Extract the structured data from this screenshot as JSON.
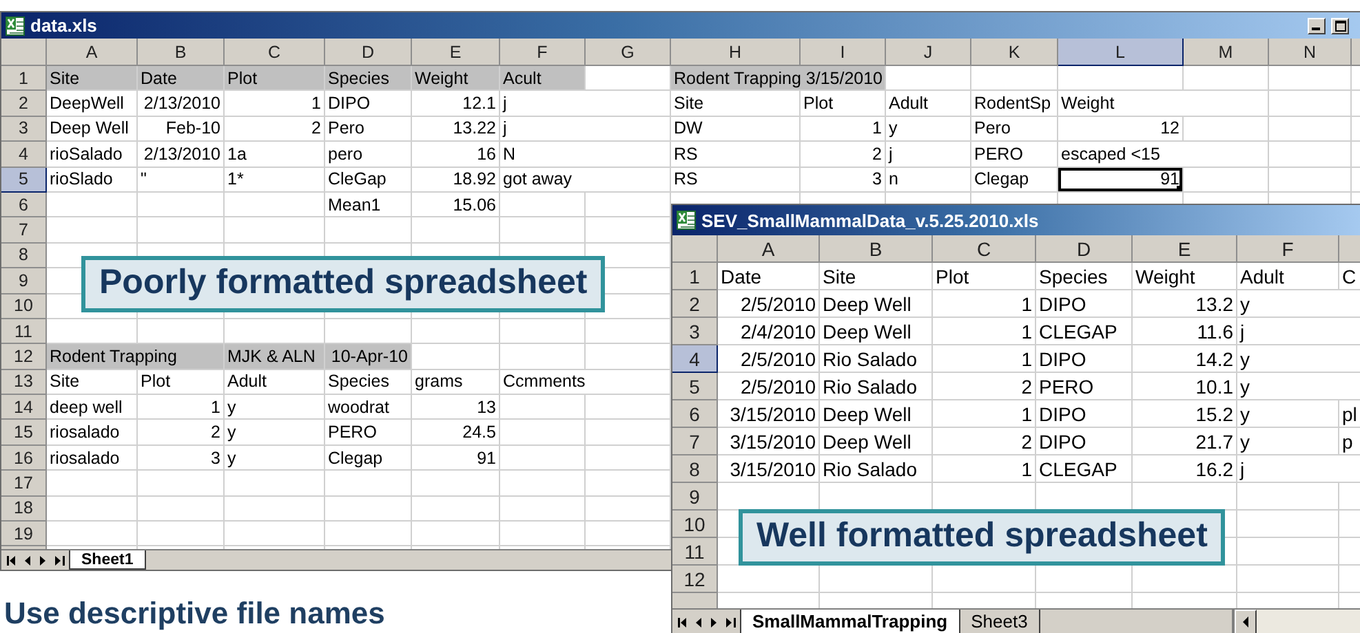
{
  "windows": [
    {
      "title": "data.xls",
      "callout": "Poorly formatted spreadsheet",
      "columns": [
        {
          "label": "A",
          "selected": false
        },
        {
          "label": "B",
          "selected": false
        },
        {
          "label": "C",
          "selected": false
        },
        {
          "label": "D",
          "selected": false
        },
        {
          "label": "E",
          "selected": false
        },
        {
          "label": "F",
          "selected": false
        },
        {
          "label": "G",
          "selected": false
        },
        {
          "label": "H",
          "selected": false
        },
        {
          "label": "I",
          "selected": false
        },
        {
          "label": "J",
          "selected": false
        },
        {
          "label": "K",
          "selected": false
        },
        {
          "label": "L",
          "selected": true
        },
        {
          "label": "M",
          "selected": false
        },
        {
          "label": "N",
          "selected": false
        }
      ],
      "rows": [
        {
          "label": "1",
          "selected": false,
          "cells": [
            {
              "text": "Site",
              "kind": "text",
              "shaded": true
            },
            {
              "text": "Date",
              "kind": "text",
              "shaded": true
            },
            {
              "text": "Plot",
              "kind": "text",
              "shaded": true
            },
            {
              "text": "Species",
              "kind": "text",
              "shaded": true
            },
            {
              "text": "Weight",
              "kind": "text",
              "shaded": true
            },
            {
              "text": "Acult",
              "kind": "text",
              "shaded": true
            },
            null,
            {
              "text": "Rodent Trapping 3/15/2010",
              "kind": "text",
              "shaded": true
            },
            {
              "shaded": true
            }
          ]
        },
        {
          "label": "2",
          "selected": false,
          "cells": [
            {
              "text": "DeepWell",
              "kind": "text",
              "shaded": false
            },
            {
              "text": "2/13/2010",
              "kind": "number",
              "shaded": false
            },
            {
              "text": "1",
              "kind": "number",
              "shaded": false
            },
            {
              "text": "DIPO",
              "kind": "text",
              "shaded": false
            },
            {
              "text": "12.1",
              "kind": "number",
              "shaded": false
            },
            {
              "text": "j",
              "kind": "text",
              "shaded": false
            },
            null,
            {
              "text": "Site",
              "kind": "text",
              "shaded": false
            },
            {
              "text": "Plot",
              "kind": "text",
              "shaded": false
            },
            {
              "text": "Adult",
              "kind": "text",
              "shaded": false
            },
            {
              "text": "RodentSp",
              "kind": "text",
              "shaded": false
            },
            {
              "text": "Weight",
              "kind": "text",
              "shaded": false
            }
          ]
        },
        {
          "label": "3",
          "selected": false,
          "cells": [
            {
              "text": "Deep Well",
              "kind": "text",
              "shaded": false
            },
            {
              "text": "Feb-10",
              "kind": "number",
              "shaded": false
            },
            {
              "text": "2",
              "kind": "number",
              "shaded": false
            },
            {
              "text": "Pero",
              "kind": "text",
              "shaded": false
            },
            {
              "text": "13.22",
              "kind": "number",
              "shaded": false
            },
            {
              "text": "j",
              "kind": "text",
              "shaded": false
            },
            null,
            {
              "text": "DW",
              "kind": "text",
              "shaded": false
            },
            {
              "text": "1",
              "kind": "number",
              "shaded": false
            },
            {
              "text": "y",
              "kind": "text",
              "shaded": false
            },
            {
              "text": "Pero",
              "kind": "text",
              "shaded": false
            },
            {
              "text": "12",
              "kind": "number",
              "shaded": false
            }
          ]
        },
        {
          "label": "4",
          "selected": false,
          "cells": [
            {
              "text": "rioSalado",
              "kind": "text",
              "shaded": false
            },
            {
              "text": "2/13/2010",
              "kind": "number",
              "shaded": false
            },
            {
              "text": "1a",
              "kind": "text",
              "shaded": false
            },
            {
              "text": "pero",
              "kind": "text",
              "shaded": false
            },
            {
              "text": "16",
              "kind": "number",
              "shaded": false
            },
            {
              "text": "N",
              "kind": "text",
              "shaded": false
            },
            null,
            {
              "text": "RS",
              "kind": "text",
              "shaded": false
            },
            {
              "text": "2",
              "kind": "number",
              "shaded": false
            },
            {
              "text": "j",
              "kind": "text",
              "shaded": false
            },
            {
              "text": "PERO",
              "kind": "text",
              "shaded": false
            },
            {
              "text": "escaped <15",
              "kind": "text",
              "shaded": false
            }
          ]
        },
        {
          "label": "5",
          "selected": true,
          "cells": [
            {
              "text": "rioSlado",
              "kind": "text",
              "shaded": false
            },
            {
              "text": "\"",
              "kind": "text",
              "shaded": false
            },
            {
              "text": "1*",
              "kind": "text",
              "shaded": false
            },
            {
              "text": "CleGap",
              "kind": "text",
              "shaded": false
            },
            {
              "text": "18.92",
              "kind": "number",
              "shaded": false
            },
            {
              "text": "got away",
              "kind": "text",
              "shaded": false
            },
            null,
            {
              "text": "RS",
              "kind": "text",
              "shaded": false
            },
            {
              "text": "3",
              "kind": "number",
              "shaded": false
            },
            {
              "text": "n",
              "kind": "text",
              "shaded": false
            },
            {
              "text": "Clegap",
              "kind": "text",
              "shaded": false
            },
            {
              "text": "91",
              "kind": "number",
              "shaded": false
            }
          ]
        },
        {
          "label": "6",
          "selected": false,
          "cells": [
            null,
            null,
            null,
            {
              "text": "Mean1",
              "kind": "text",
              "shaded": false
            },
            {
              "text": "15.06",
              "kind": "number",
              "shaded": false
            }
          ]
        },
        {
          "label": "7",
          "selected": false,
          "cells": []
        },
        {
          "label": "8",
          "selected": false,
          "cells": []
        },
        {
          "label": "9",
          "selected": false,
          "cells": []
        },
        {
          "label": "10",
          "selected": false,
          "cells": []
        },
        {
          "label": "11",
          "selected": false,
          "cells": []
        },
        {
          "label": "12",
          "selected": false,
          "cells": [
            {
              "text": "Rodent Trapping",
              "kind": "text",
              "shaded": true
            },
            {
              "shaded": true
            },
            {
              "text": "MJK & ALN",
              "kind": "text",
              "shaded": true
            },
            {
              "text": "10-Apr-10",
              "kind": "number",
              "shaded": true
            }
          ]
        },
        {
          "label": "13",
          "selected": false,
          "cells": [
            {
              "text": "Site",
              "kind": "text",
              "shaded": false
            },
            {
              "text": "Plot",
              "kind": "text",
              "shaded": false
            },
            {
              "text": "Adult",
              "kind": "text",
              "shaded": false
            },
            {
              "text": "Species",
              "kind": "text",
              "shaded": false
            },
            {
              "text": "grams",
              "kind": "text",
              "shaded": false
            },
            {
              "text": "Ccmments",
              "kind": "text",
              "shaded": false
            }
          ]
        },
        {
          "label": "14",
          "selected": false,
          "cells": [
            {
              "text": "deep well",
              "kind": "text",
              "shaded": false
            },
            {
              "text": "1",
              "kind": "number",
              "shaded": false
            },
            {
              "text": "y",
              "kind": "text",
              "shaded": false
            },
            {
              "text": "woodrat",
              "kind": "text",
              "shaded": false
            },
            {
              "text": "13",
              "kind": "number",
              "shaded": false
            }
          ]
        },
        {
          "label": "15",
          "selected": false,
          "cells": [
            {
              "text": "riosalado",
              "kind": "text",
              "shaded": false
            },
            {
              "text": "2",
              "kind": "number",
              "shaded": false
            },
            {
              "text": "y",
              "kind": "text",
              "shaded": false
            },
            {
              "text": "PERO",
              "kind": "text",
              "shaded": false
            },
            {
              "text": "24.5",
              "kind": "number",
              "shaded": false
            }
          ]
        },
        {
          "label": "16",
          "selected": false,
          "cells": [
            {
              "text": "riosalado",
              "kind": "text",
              "shaded": false
            },
            {
              "text": "3",
              "kind": "number",
              "shaded": false
            },
            {
              "text": "y",
              "kind": "text",
              "shaded": false
            },
            {
              "text": "Clegap",
              "kind": "text",
              "shaded": false
            },
            {
              "text": "91",
              "kind": "number",
              "shaded": false
            }
          ]
        },
        {
          "label": "17",
          "selected": false,
          "cells": []
        },
        {
          "label": "18",
          "selected": false,
          "cells": []
        },
        {
          "label": "19",
          "selected": false,
          "cells": []
        }
      ],
      "tabs": [
        {
          "label": "Sheet1",
          "selected": true
        }
      ]
    },
    {
      "title": "SEV_SmallMammalData_v.5.25.2010.xls",
      "callout": "Well formatted spreadsheet",
      "columns": [
        {
          "label": "A",
          "selected": false
        },
        {
          "label": "B",
          "selected": false
        },
        {
          "label": "C",
          "selected": false
        },
        {
          "label": "D",
          "selected": false
        },
        {
          "label": "E",
          "selected": false
        },
        {
          "label": "F",
          "selected": false
        },
        {
          "selected": false
        }
      ],
      "rows": [
        {
          "label": "1",
          "selected": false,
          "cells": [
            {
              "text": "Date",
              "kind": "text",
              "shaded": false
            },
            {
              "text": "Site",
              "kind": "text",
              "shaded": false
            },
            {
              "text": "Plot",
              "kind": "text",
              "shaded": false
            },
            {
              "text": "Species",
              "kind": "text",
              "shaded": false
            },
            {
              "text": "Weight",
              "kind": "text",
              "shaded": false
            },
            {
              "text": "Adult",
              "kind": "text",
              "shaded": false
            },
            {
              "text": "C",
              "kind": "text",
              "shaded": false
            }
          ]
        },
        {
          "label": "2",
          "selected": false,
          "cells": [
            {
              "text": "2/5/2010",
              "kind": "number",
              "shaded": false
            },
            {
              "text": "Deep Well",
              "kind": "text",
              "shaded": false
            },
            {
              "text": "1",
              "kind": "number",
              "shaded": false
            },
            {
              "text": "DIPO",
              "kind": "text",
              "shaded": false
            },
            {
              "text": "13.2",
              "kind": "number",
              "shaded": false
            },
            {
              "text": "y",
              "kind": "text",
              "shaded": false
            }
          ]
        },
        {
          "label": "3",
          "selected": false,
          "cells": [
            {
              "text": "2/4/2010",
              "kind": "number",
              "shaded": false
            },
            {
              "text": "Deep Well",
              "kind": "text",
              "shaded": false
            },
            {
              "text": "1",
              "kind": "number",
              "shaded": false
            },
            {
              "text": "CLEGAP",
              "kind": "text",
              "shaded": false
            },
            {
              "text": "11.6",
              "kind": "number",
              "shaded": false
            },
            {
              "text": "j",
              "kind": "text",
              "shaded": false
            }
          ]
        },
        {
          "label": "4",
          "selected": true,
          "cells": [
            {
              "text": "2/5/2010",
              "kind": "number",
              "shaded": false
            },
            {
              "text": "Rio Salado",
              "kind": "text",
              "shaded": false
            },
            {
              "text": "1",
              "kind": "number",
              "shaded": false
            },
            {
              "text": "DIPO",
              "kind": "text",
              "shaded": false
            },
            {
              "text": "14.2",
              "kind": "number",
              "shaded": false
            },
            {
              "text": "y",
              "kind": "text",
              "shaded": false
            }
          ]
        },
        {
          "label": "5",
          "selected": false,
          "cells": [
            {
              "text": "2/5/2010",
              "kind": "number",
              "shaded": false
            },
            {
              "text": "Rio Salado",
              "kind": "text",
              "shaded": false
            },
            {
              "text": "2",
              "kind": "number",
              "shaded": false
            },
            {
              "text": "PERO",
              "kind": "text",
              "shaded": false
            },
            {
              "text": "10.1",
              "kind": "number",
              "shaded": false
            },
            {
              "text": "y",
              "kind": "text",
              "shaded": false
            }
          ]
        },
        {
          "label": "6",
          "selected": false,
          "cells": [
            {
              "text": "3/15/2010",
              "kind": "number",
              "shaded": false
            },
            {
              "text": "Deep Well",
              "kind": "text",
              "shaded": false
            },
            {
              "text": "1",
              "kind": "number",
              "shaded": false
            },
            {
              "text": "DIPO",
              "kind": "text",
              "shaded": false
            },
            {
              "text": "15.2",
              "kind": "number",
              "shaded": false
            },
            {
              "text": "y",
              "kind": "text",
              "shaded": false
            },
            {
              "text": "pl",
              "kind": "text",
              "shaded": false
            }
          ]
        },
        {
          "label": "7",
          "selected": false,
          "cells": [
            {
              "text": "3/15/2010",
              "kind": "number",
              "shaded": false
            },
            {
              "text": "Deep Well",
              "kind": "text",
              "shaded": false
            },
            {
              "text": "2",
              "kind": "number",
              "shaded": false
            },
            {
              "text": "DIPO",
              "kind": "text",
              "shaded": false
            },
            {
              "text": "21.7",
              "kind": "number",
              "shaded": false
            },
            {
              "text": "y",
              "kind": "text",
              "shaded": false
            },
            {
              "text": "p",
              "kind": "text",
              "shaded": false
            }
          ]
        },
        {
          "label": "8",
          "selected": false,
          "cells": [
            {
              "text": "3/15/2010",
              "kind": "number",
              "shaded": false
            },
            {
              "text": "Rio Salado",
              "kind": "text",
              "shaded": false
            },
            {
              "text": "1",
              "kind": "number",
              "shaded": false
            },
            {
              "text": "CLEGAP",
              "kind": "text",
              "shaded": false
            },
            {
              "text": "16.2",
              "kind": "number",
              "shaded": false
            },
            {
              "text": "j",
              "kind": "text",
              "shaded": false
            }
          ]
        },
        {
          "label": "9",
          "selected": false,
          "cells": []
        },
        {
          "label": "10",
          "selected": false,
          "cells": []
        },
        {
          "label": "11",
          "selected": false,
          "cells": []
        },
        {
          "label": "12",
          "selected": false,
          "cells": []
        }
      ],
      "tabs": [
        {
          "label": "SmallMammalTrapping",
          "selected": true
        },
        {
          "label": "Sheet3",
          "selected": false
        }
      ]
    }
  ],
  "caption": "Use descriptive file names"
}
